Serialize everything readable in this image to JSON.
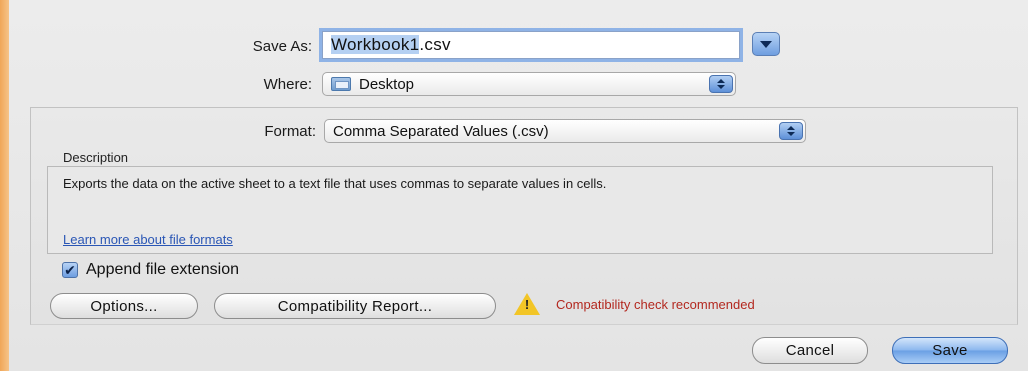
{
  "dialog": {
    "save_as_label": "Save As:",
    "file_name_selected": "Workbook1",
    "file_name_ext": ".csv",
    "where_label": "Where:",
    "where_value": "Desktop",
    "format_label": "Format:",
    "format_value": "Comma Separated Values (.csv)",
    "description_title": "Description",
    "description_text": "Exports the data on the active sheet to a text file that uses commas to separate values in cells.",
    "learn_more_link": "Learn more about file formats",
    "append_extension_label": "Append file extension",
    "append_extension_checked": true,
    "options_button": "Options...",
    "compat_button": "Compatibility Report...",
    "warning_text": "Compatibility check recommended",
    "cancel_button": "Cancel",
    "save_button": "Save"
  },
  "icons": {
    "disclosure": "chevron-down-icon",
    "folder": "folder-icon",
    "warning": "warning-icon",
    "checkmark": "✔"
  },
  "colors": {
    "accent": "#6f9ee0",
    "link": "#2a56b5",
    "warning_text": "#b3281f",
    "warning_icon": "#f2c526"
  }
}
